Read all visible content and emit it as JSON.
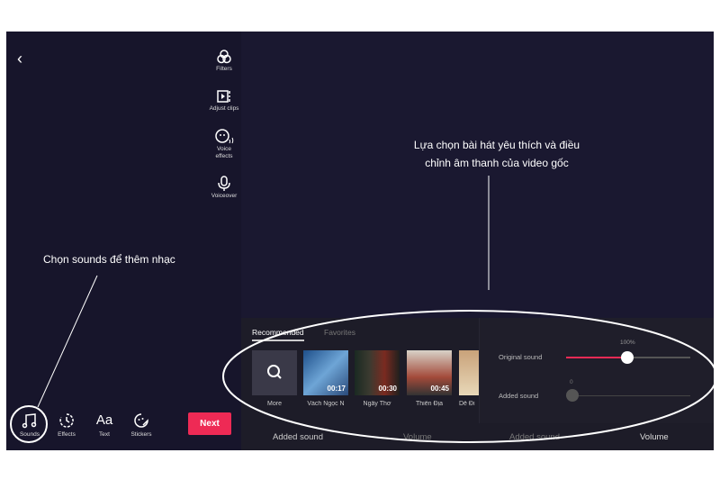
{
  "editor": {
    "back_icon": "chevron-left-icon",
    "tools": [
      {
        "label": "Filters",
        "icon": "filters-icon"
      },
      {
        "label": "Adjust clips",
        "icon": "adjust-clips-icon"
      },
      {
        "label": "Voice effects",
        "icon": "voice-effects-icon"
      },
      {
        "label": "Voiceover",
        "icon": "microphone-icon"
      }
    ],
    "bottom": [
      {
        "label": "Sounds",
        "icon": "music-note-icon"
      },
      {
        "label": "Effects",
        "icon": "effects-timer-icon"
      },
      {
        "label": "Text",
        "icon": "text-aa-icon"
      },
      {
        "label": "Stickers",
        "icon": "sticker-icon"
      }
    ],
    "text_glyph": "Aa",
    "next_label": "Next",
    "accent": "#ee2a55"
  },
  "sounds": {
    "tabs": [
      "Recommended",
      "Favorites"
    ],
    "active_tab": "Recommended",
    "more_label": "More",
    "tracks": [
      {
        "title": "Vách Ngọc N",
        "duration": "00:17"
      },
      {
        "title": "Ngây Thơ",
        "duration": "00:30"
      },
      {
        "title": "Thiên Địa",
        "duration": "00:45"
      },
      {
        "title": "Dễ Đi",
        "duration": ""
      }
    ]
  },
  "volume": {
    "original_label": "Original sound",
    "original_value": "100%",
    "original_fraction": 0.5,
    "added_label": "Added sound",
    "added_value": "0"
  },
  "bottom_tabs": [
    "Added sound",
    "Volume",
    "Added sound",
    "Volume"
  ],
  "annotations": {
    "left_note": "Chọn sounds để thêm nhạc",
    "right_note_1": "Lựa chọn bài hát yêu thích và điều",
    "right_note_2": "chỉnh âm thanh của video gốc"
  }
}
